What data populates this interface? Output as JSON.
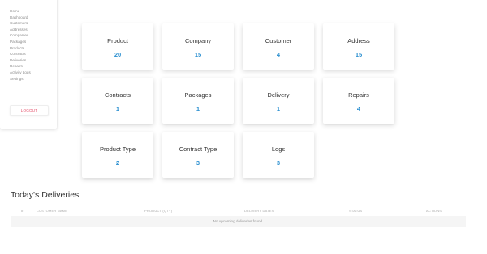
{
  "sidebar": {
    "caret": "▾",
    "items": [
      {
        "label": "Home"
      },
      {
        "label": "Dashboard"
      },
      {
        "label": "Customers"
      },
      {
        "label": "Addresses"
      },
      {
        "label": "Companies"
      },
      {
        "label": "Packages"
      },
      {
        "label": "Products"
      },
      {
        "label": "Contracts"
      },
      {
        "label": "Deliveries"
      },
      {
        "label": "Repairs"
      },
      {
        "label": "Activity Logs"
      },
      {
        "label": "Settings"
      }
    ],
    "logout_label": "LOGOUT"
  },
  "stats": [
    {
      "label": "Product",
      "count": "20"
    },
    {
      "label": "Company",
      "count": "15"
    },
    {
      "label": "Customer",
      "count": "4"
    },
    {
      "label": "Address",
      "count": "15"
    },
    {
      "label": "Contracts",
      "count": "1"
    },
    {
      "label": "Packages",
      "count": "1"
    },
    {
      "label": "Delivery",
      "count": "1"
    },
    {
      "label": "Repairs",
      "count": "4"
    },
    {
      "label": "Product Type",
      "count": "2"
    },
    {
      "label": "Contract Type",
      "count": "3"
    },
    {
      "label": "Logs",
      "count": "3"
    }
  ],
  "deliveries": {
    "title": "Today's Deliveries",
    "columns": [
      "#",
      "CUSTOMER NAME",
      "PRODUCT (QTY)",
      "DELIVERY DATES",
      "STATUS",
      "ACTIONS"
    ],
    "empty_message": "No upcoming deliveries found."
  },
  "colors": {
    "accent": "#2a8fd0",
    "logout": "#e5506b"
  }
}
